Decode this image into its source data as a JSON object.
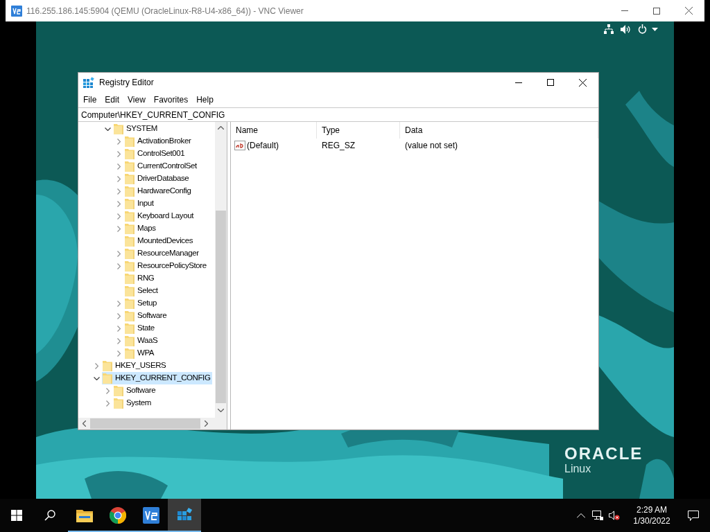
{
  "vnc_window": {
    "title": "116.255.186.145:5904 (QEMU (OracleLinux-R8-U4-x86_64)) - VNC Viewer"
  },
  "desktop": {
    "logo": {
      "brand": "ORACLE",
      "product": "Linux"
    }
  },
  "registry_editor": {
    "title": "Registry Editor",
    "menu": [
      "File",
      "Edit",
      "View",
      "Favorites",
      "Help"
    ],
    "address": "Computer\\HKEY_CURRENT_CONFIG",
    "tree": [
      {
        "children": [
          {
            "label": "SYSTEM",
            "expanded": true,
            "selected": false,
            "children": [
              {
                "label": "ActivationBroker",
                "expanded": false,
                "selected": false
              },
              {
                "label": "ControlSet001",
                "expanded": false,
                "selected": false
              },
              {
                "label": "CurrentControlSet",
                "expanded": false,
                "selected": false
              },
              {
                "label": "DriverDatabase",
                "expanded": false,
                "selected": false
              },
              {
                "label": "HardwareConfig",
                "expanded": false,
                "selected": false
              },
              {
                "label": "Input",
                "expanded": false,
                "selected": false
              },
              {
                "label": "Keyboard Layout",
                "expanded": false,
                "selected": false
              },
              {
                "label": "Maps",
                "expanded": false,
                "selected": false
              },
              {
                "label": "MountedDevices",
                "selected": false
              },
              {
                "label": "ResourceManager",
                "expanded": false,
                "selected": false
              },
              {
                "label": "ResourcePolicyStore",
                "expanded": false,
                "selected": false
              },
              {
                "label": "RNG",
                "selected": false
              },
              {
                "label": "Select",
                "selected": false
              },
              {
                "label": "Setup",
                "expanded": false,
                "selected": false
              },
              {
                "label": "Software",
                "expanded": false,
                "selected": false
              },
              {
                "label": "State",
                "expanded": false,
                "selected": false
              },
              {
                "label": "WaaS",
                "expanded": false,
                "selected": false
              },
              {
                "label": "WPA",
                "expanded": false,
                "selected": false
              }
            ]
          }
        ]
      },
      {
        "label": "HKEY_USERS",
        "expanded": false,
        "selected": false
      },
      {
        "label": "HKEY_CURRENT_CONFIG",
        "expanded": true,
        "selected": true,
        "children": [
          {
            "label": "Software",
            "expanded": false,
            "selected": false
          },
          {
            "label": "System",
            "expanded": false,
            "selected": false
          }
        ]
      }
    ],
    "table": {
      "columns": [
        "Name",
        "Type",
        "Data"
      ],
      "rows": [
        {
          "name": "(Default)",
          "type": "REG_SZ",
          "data": "(value not set)"
        }
      ]
    }
  },
  "taskbar": {
    "apps": [
      {
        "kind": "folder",
        "selected": false
      },
      {
        "kind": "chrome",
        "selected": false
      },
      {
        "kind": "vnc",
        "selected": false
      },
      {
        "kind": "regedit",
        "selected": true
      }
    ],
    "clock": {
      "time": "2:29 AM",
      "date": "1/30/2022"
    }
  }
}
